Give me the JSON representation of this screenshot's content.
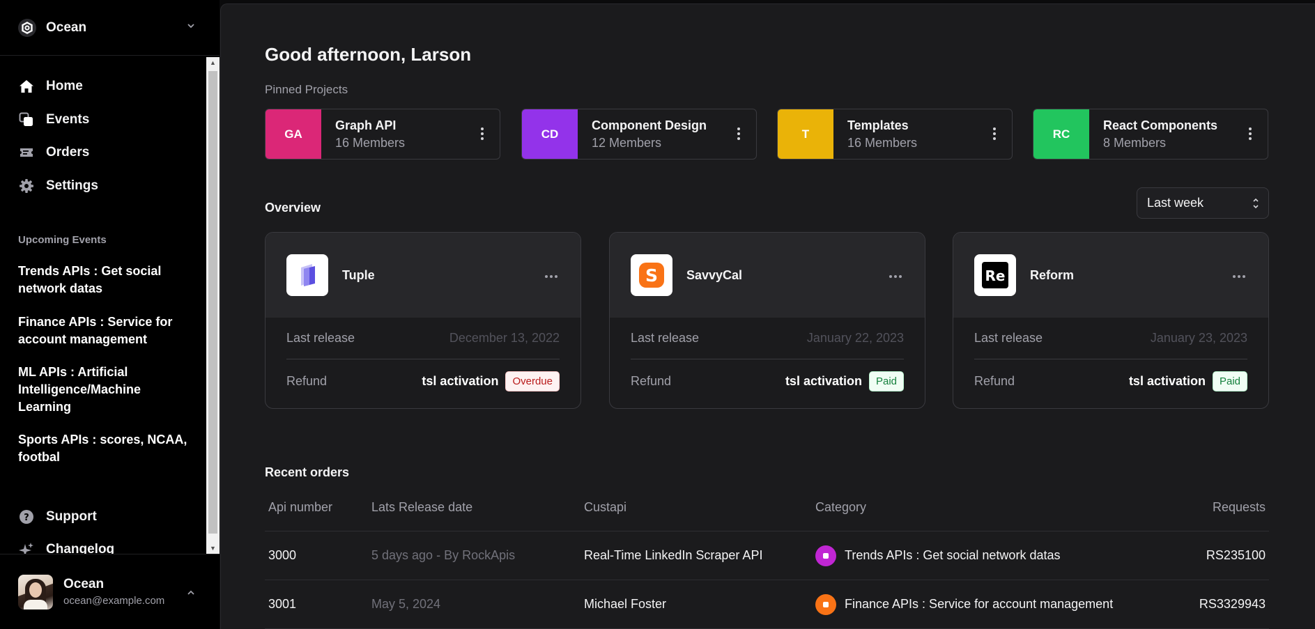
{
  "team": {
    "name": "Ocean"
  },
  "nav": [
    {
      "label": "Home",
      "icon": "home-icon"
    },
    {
      "label": "Events",
      "icon": "square-stack-icon"
    },
    {
      "label": "Orders",
      "icon": "ticket-icon"
    },
    {
      "label": "Settings",
      "icon": "gear-icon"
    }
  ],
  "upcoming": {
    "heading": "Upcoming Events",
    "events": [
      "Trends APIs : Get social network datas",
      "Finance APIs : Service for account management",
      "ML APIs : Artificial Intelligence/Machine Learning",
      "Sports APIs : scores, NCAA, footbal"
    ]
  },
  "footer_nav": [
    {
      "label": "Support",
      "icon": "question-icon"
    },
    {
      "label": "Changelog",
      "icon": "sparkles-icon"
    }
  ],
  "user": {
    "name": "Ocean",
    "email": "ocean@example.com"
  },
  "greeting": "Good afternoon, Larson",
  "pinned": {
    "heading": "Pinned Projects",
    "projects": [
      {
        "initials": "GA",
        "name": "Graph API",
        "members": "16 Members",
        "color": "#db2777"
      },
      {
        "initials": "CD",
        "name": "Component Design",
        "members": "12 Members",
        "color": "#9333ea"
      },
      {
        "initials": "T",
        "name": "Templates",
        "members": "16 Members",
        "color": "#eab308"
      },
      {
        "initials": "RC",
        "name": "React Components",
        "members": "8 Members",
        "color": "#22c55e"
      }
    ]
  },
  "overview": {
    "heading": "Overview",
    "period": "Last week",
    "cards": [
      {
        "name": "Tuple",
        "logo": "tuple-logo",
        "release_label": "Last release",
        "release_date": "December 13, 2022",
        "refund_label": "Refund",
        "refund_value": "tsl activation",
        "status": "Overdue"
      },
      {
        "name": "SavvyCal",
        "logo": "savvycal-logo",
        "release_label": "Last release",
        "release_date": "January 22, 2023",
        "refund_label": "Refund",
        "refund_value": "tsl activation",
        "status": "Paid"
      },
      {
        "name": "Reform",
        "logo": "reform-logo",
        "release_label": "Last release",
        "release_date": "January 23, 2023",
        "refund_label": "Refund",
        "refund_value": "tsl activation",
        "status": "Paid"
      }
    ]
  },
  "orders": {
    "heading": "Recent orders",
    "columns": [
      "Api number",
      "Lats Release date",
      "Custapi",
      "Category",
      "Requests"
    ],
    "rows": [
      {
        "number": "3000",
        "date": "5 days ago - By RockApis",
        "custapi": "Real-Time LinkedIn Scraper API",
        "category": "Trends APIs : Get social network datas",
        "category_color": "#c026d3",
        "requests": "RS235100"
      },
      {
        "number": "3001",
        "date": "May 5, 2024",
        "custapi": "Michael Foster",
        "category": "Finance APIs : Service for account management",
        "category_color": "#f97316",
        "requests": "RS3329943"
      }
    ]
  }
}
